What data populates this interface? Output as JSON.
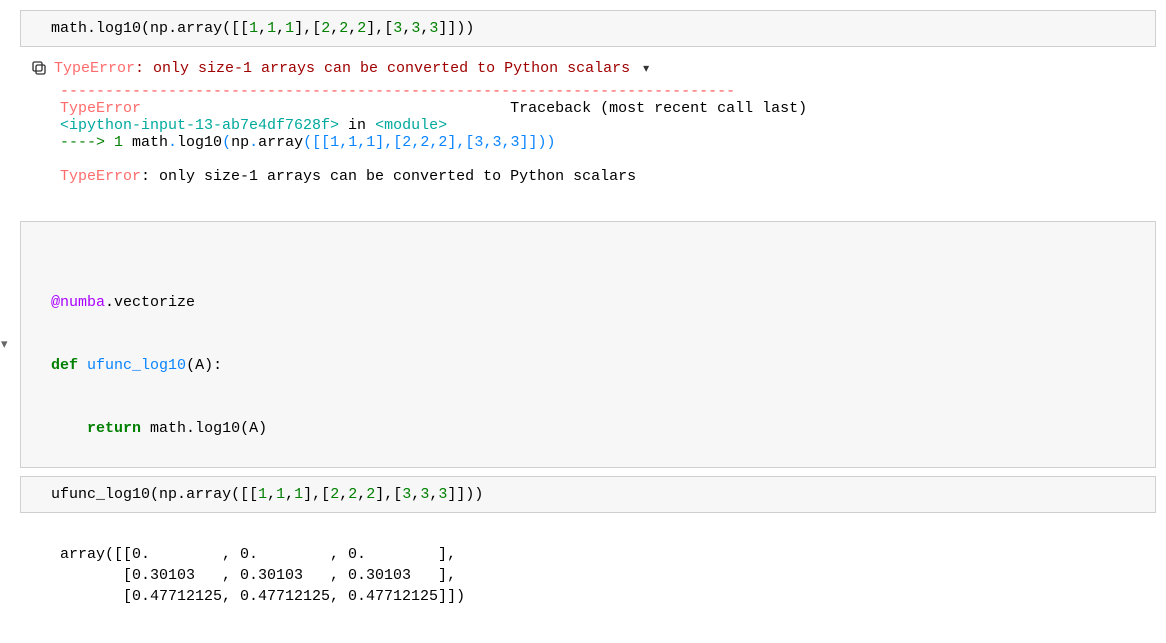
{
  "cell1": {
    "tokens": [
      {
        "t": "math",
        "c": ""
      },
      {
        "t": ".",
        "c": ""
      },
      {
        "t": "log10",
        "c": ""
      },
      {
        "t": "(np",
        "c": ""
      },
      {
        "t": ".",
        "c": ""
      },
      {
        "t": "array",
        "c": ""
      },
      {
        "t": "([[",
        "c": ""
      },
      {
        "t": "1",
        "c": "num-green"
      },
      {
        "t": ",",
        "c": ""
      },
      {
        "t": "1",
        "c": "num-green"
      },
      {
        "t": ",",
        "c": ""
      },
      {
        "t": "1",
        "c": "num-green"
      },
      {
        "t": "],[",
        "c": ""
      },
      {
        "t": "2",
        "c": "num-green"
      },
      {
        "t": ",",
        "c": ""
      },
      {
        "t": "2",
        "c": "num-green"
      },
      {
        "t": ",",
        "c": ""
      },
      {
        "t": "2",
        "c": "num-green"
      },
      {
        "t": "],[",
        "c": ""
      },
      {
        "t": "3",
        "c": "num-green"
      },
      {
        "t": ",",
        "c": ""
      },
      {
        "t": "3",
        "c": "num-green"
      },
      {
        "t": ",",
        "c": ""
      },
      {
        "t": "3",
        "c": "num-green"
      },
      {
        "t": "]]))",
        "c": ""
      }
    ]
  },
  "error": {
    "name": "TypeError",
    "message": ": only size-1 arrays can be converted to Python scalars",
    "chevron": "▾",
    "divider": "---------------------------------------------------------------------------",
    "traceback_header_left": "TypeError",
    "traceback_header_right": "Traceback (most recent call last)",
    "input_ref": "<ipython-input-13-ab7e4df7628f>",
    "in_text": " in ",
    "module_text": "<module>",
    "arrow": "----> 1 ",
    "call_tokens": [
      {
        "t": "math",
        "c": ""
      },
      {
        "t": ".",
        "c": "blue"
      },
      {
        "t": "log10",
        "c": ""
      },
      {
        "t": "(",
        "c": "blue"
      },
      {
        "t": "np",
        "c": ""
      },
      {
        "t": ".",
        "c": "blue"
      },
      {
        "t": "array",
        "c": ""
      },
      {
        "t": "(",
        "c": "blue"
      },
      {
        "t": "[",
        "c": "blue"
      },
      {
        "t": "[",
        "c": "blue"
      },
      {
        "t": "1",
        "c": "blue"
      },
      {
        "t": ",",
        "c": "blue"
      },
      {
        "t": "1",
        "c": "blue"
      },
      {
        "t": ",",
        "c": "blue"
      },
      {
        "t": "1",
        "c": "blue"
      },
      {
        "t": "]",
        "c": "blue"
      },
      {
        "t": ",",
        "c": "blue"
      },
      {
        "t": "[",
        "c": "blue"
      },
      {
        "t": "2",
        "c": "blue"
      },
      {
        "t": ",",
        "c": "blue"
      },
      {
        "t": "2",
        "c": "blue"
      },
      {
        "t": ",",
        "c": "blue"
      },
      {
        "t": "2",
        "c": "blue"
      },
      {
        "t": "]",
        "c": "blue"
      },
      {
        "t": ",",
        "c": "blue"
      },
      {
        "t": "[",
        "c": "blue"
      },
      {
        "t": "3",
        "c": "blue"
      },
      {
        "t": ",",
        "c": "blue"
      },
      {
        "t": "3",
        "c": "blue"
      },
      {
        "t": ",",
        "c": "blue"
      },
      {
        "t": "3",
        "c": "blue"
      },
      {
        "t": "]",
        "c": "blue"
      },
      {
        "t": "]",
        "c": "blue"
      },
      {
        "t": ")",
        "c": "blue"
      },
      {
        "t": ")",
        "c": "blue"
      }
    ],
    "final_name": "TypeError",
    "final_msg": ": only size-1 arrays can be converted to Python scalars"
  },
  "cell2": {
    "line1_tokens": [
      {
        "t": "@numba",
        "c": "purple"
      },
      {
        "t": ".",
        "c": ""
      },
      {
        "t": "vectorize",
        "c": ""
      }
    ],
    "line2_tokens": [
      {
        "t": "def",
        "c": "green bold"
      },
      {
        "t": " ",
        "c": ""
      },
      {
        "t": "ufunc_log10",
        "c": "blue"
      },
      {
        "t": "(A):",
        "c": ""
      }
    ],
    "line3_tokens": [
      {
        "t": "    ",
        "c": ""
      },
      {
        "t": "return",
        "c": "green bold"
      },
      {
        "t": " math",
        "c": ""
      },
      {
        "t": ".",
        "c": ""
      },
      {
        "t": "log10",
        "c": ""
      },
      {
        "t": "(A)",
        "c": ""
      }
    ]
  },
  "cell3": {
    "tokens": [
      {
        "t": "ufunc_log10",
        "c": ""
      },
      {
        "t": "(np",
        "c": ""
      },
      {
        "t": ".",
        "c": ""
      },
      {
        "t": "array",
        "c": ""
      },
      {
        "t": "([[",
        "c": ""
      },
      {
        "t": "1",
        "c": "num-green"
      },
      {
        "t": ",",
        "c": ""
      },
      {
        "t": "1",
        "c": "num-green"
      },
      {
        "t": ",",
        "c": ""
      },
      {
        "t": "1",
        "c": "num-green"
      },
      {
        "t": "],[",
        "c": ""
      },
      {
        "t": "2",
        "c": "num-green"
      },
      {
        "t": ",",
        "c": ""
      },
      {
        "t": "2",
        "c": "num-green"
      },
      {
        "t": ",",
        "c": ""
      },
      {
        "t": "2",
        "c": "num-green"
      },
      {
        "t": "],[",
        "c": ""
      },
      {
        "t": "3",
        "c": "num-green"
      },
      {
        "t": ",",
        "c": ""
      },
      {
        "t": "3",
        "c": "num-green"
      },
      {
        "t": ",",
        "c": ""
      },
      {
        "t": "3",
        "c": "num-green"
      },
      {
        "t": "]]))",
        "c": ""
      }
    ]
  },
  "output3": {
    "line1": "array([[0.        , 0.        , 0.        ],",
    "line2": "       [0.30103   , 0.30103   , 0.30103   ],",
    "line3": "       [0.47712125, 0.47712125, 0.47712125]])"
  }
}
